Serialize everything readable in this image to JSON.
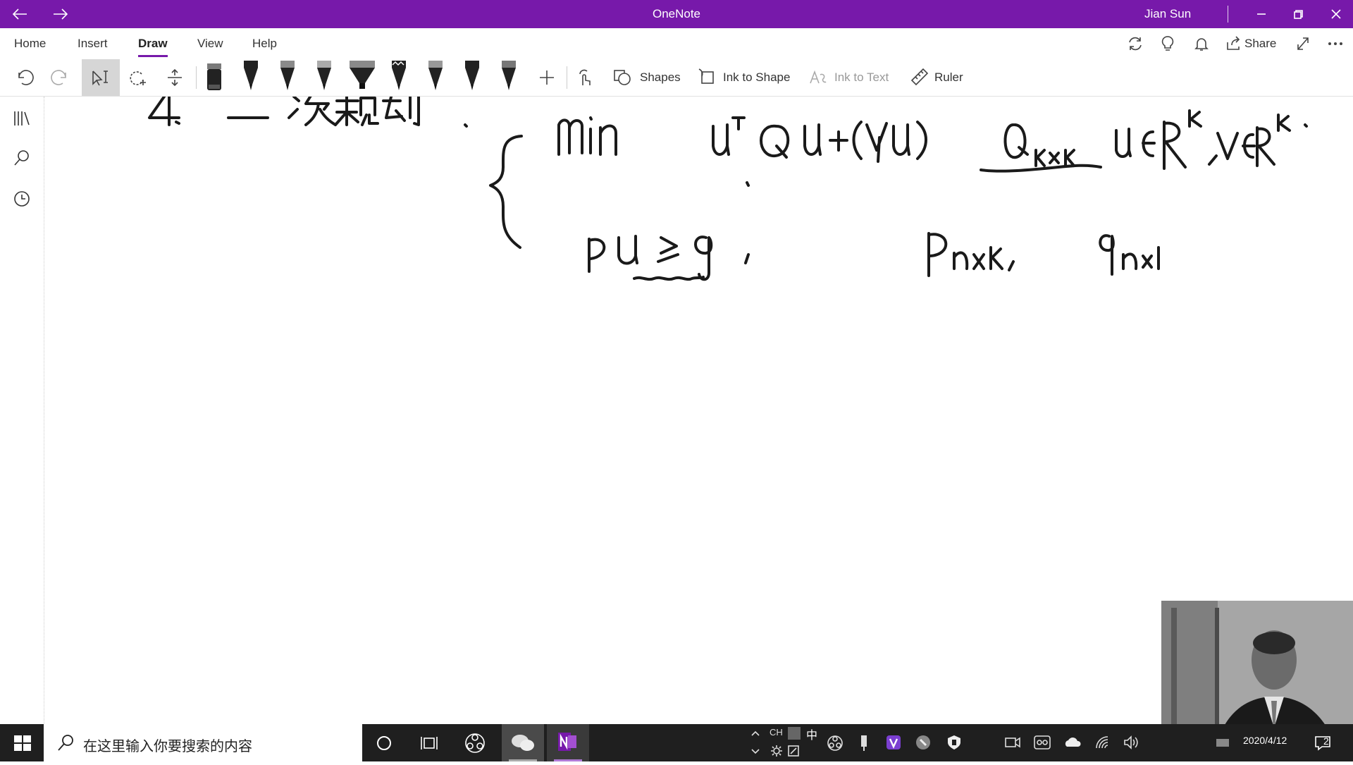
{
  "app": {
    "title": "OneNote",
    "user": "Jian Sun"
  },
  "menu": {
    "tabs": [
      "Home",
      "Insert",
      "Draw",
      "View",
      "Help"
    ],
    "active": "Draw"
  },
  "header_actions": {
    "share_label": "Share"
  },
  "toolbar": {
    "shapes_label": "Shapes",
    "ink_to_shape_label": "Ink to Shape",
    "ink_to_text_label": "Ink to Text",
    "ruler_label": "Ruler"
  },
  "pens": [
    "black-pen",
    "black-pen",
    "gray-pen",
    "gray-pen",
    "highlighter",
    "wavy-pen",
    "gray-pen",
    "black-pen",
    "gray-pen"
  ],
  "taskbar": {
    "search_placeholder": "在这里输入你要搜索的内容",
    "ime_mode": "CH",
    "ime_char": "中",
    "date": "2020/4/12",
    "notification_count": "2"
  },
  "colors": {
    "accent": "#7719aa",
    "taskbar": "#1f1f1f"
  }
}
